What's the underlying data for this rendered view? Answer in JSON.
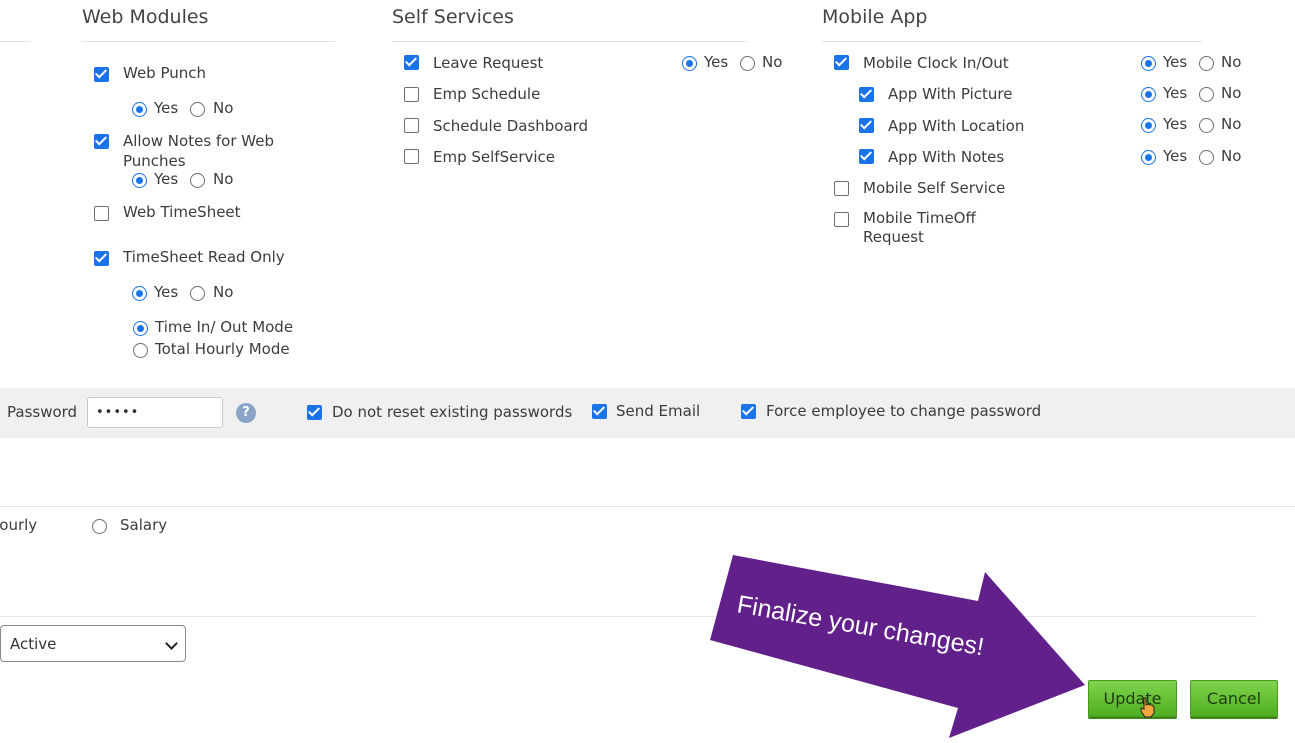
{
  "sections": {
    "web_modules": {
      "title": "Web Modules",
      "items": {
        "web_punch": "Web Punch",
        "allow_notes": "Allow Notes for Web Punches",
        "web_timesheet": "Web TimeSheet",
        "timesheet_readonly": "TimeSheet Read Only",
        "time_in_out_mode": "Time In/ Out Mode",
        "total_hourly_mode": "Total Hourly Mode"
      }
    },
    "self_services": {
      "title": "Self Services",
      "items": {
        "leave_request": "Leave Request",
        "emp_schedule": "Emp Schedule",
        "schedule_dashboard": "Schedule Dashboard",
        "emp_selfservice": "Emp SelfService"
      }
    },
    "mobile_app": {
      "title": "Mobile App",
      "items": {
        "mobile_clock": "Mobile Clock In/Out",
        "app_picture": "App With Picture",
        "app_location": "App With Location",
        "app_notes": "App With Notes",
        "mobile_self_service": "Mobile Self Service",
        "mobile_timeoff": "Mobile TimeOff Request"
      }
    }
  },
  "radio": {
    "yes": "Yes",
    "no": "No"
  },
  "password_row": {
    "label": "Password",
    "value": "•••••",
    "help": "?",
    "do_not_reset": "Do not reset existing passwords",
    "send_email": "Send Email",
    "force_change": "Force employee to change password"
  },
  "pay_type": {
    "hourly": "Hourly",
    "salary": "Salary"
  },
  "status_select": {
    "value": "Active"
  },
  "buttons": {
    "update": "Update",
    "cancel": "Cancel"
  },
  "callout": {
    "text": "Finalize your changes!"
  },
  "colors": {
    "accent": "#1a73e8",
    "button_green": "#5cbf2a",
    "callout_purple": "#62208a"
  }
}
